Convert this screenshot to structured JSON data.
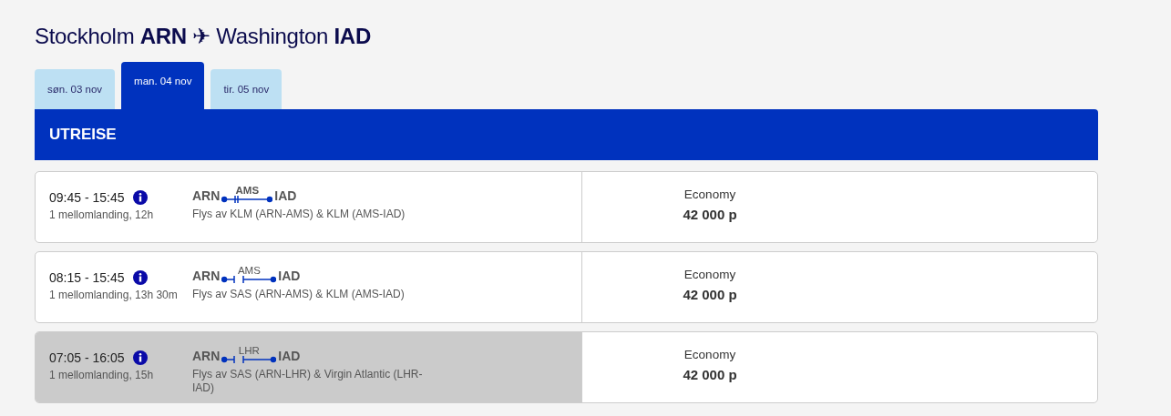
{
  "title": "Stockholm **ARN** ✈ Washington **IAD**",
  "tabs": [
    {
      "label": "søn. 03 nov",
      "selected": false
    },
    {
      "label": "man. 04 nov",
      "selected": true
    },
    {
      "label": "tir. 05 nov",
      "selected": false
    }
  ],
  "section_header": "UTREISE",
  "flights": [
    {
      "times": "09:45 - 15:45",
      "stops": "1 mellomlanding, 12h",
      "origin": "ARN",
      "via": "AMS",
      "destination": "IAD",
      "kind": "through",
      "operators": "Flys av KLM (ARN-AMS) & KLM (AMS-IAD)",
      "cabin": "Economy",
      "price": "42 000 p",
      "highlighted": false
    },
    {
      "times": "08:15 - 15:45",
      "stops": "1 mellomlanding, 13h 30m",
      "origin": "ARN",
      "via": "AMS",
      "destination": "IAD",
      "kind": "gap",
      "operators": "Flys av SAS (ARN-AMS) & KLM (AMS-IAD)",
      "cabin": "Economy",
      "price": "42 000 p",
      "highlighted": false
    },
    {
      "times": "07:05 - 16:05",
      "stops": "1 mellomlanding, 15h",
      "origin": "ARN",
      "via": "LHR",
      "destination": "IAD",
      "kind": "gap",
      "operators": "Flys av SAS (ARN-LHR) & Virgin Atlantic (LHR-IAD)",
      "cabin": "Economy",
      "price": "42 000 p",
      "highlighted": true
    }
  ]
}
